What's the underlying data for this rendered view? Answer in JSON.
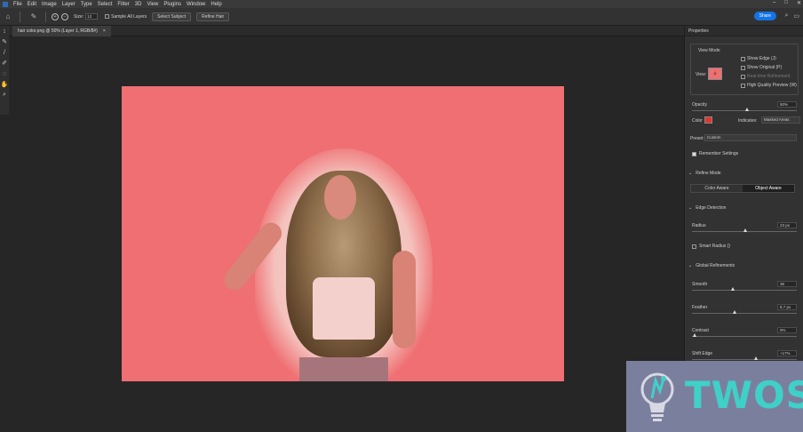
{
  "menubar": {
    "items": [
      "File",
      "Edit",
      "Image",
      "Layer",
      "Type",
      "Select",
      "Filter",
      "3D",
      "View",
      "Plugins",
      "Window",
      "Help"
    ],
    "win_controls": [
      "–",
      "□",
      "✕"
    ]
  },
  "options": {
    "size_label": "Size:",
    "size_value": "13",
    "sample_all_layers": "Sample All Layers",
    "select_subject": "Select Subject",
    "refine_hair": "Refine Hair",
    "share": "Share"
  },
  "document": {
    "tab_title": "hair color.png @ 50% (Layer 1, RGB/8#)",
    "close": "×"
  },
  "properties": {
    "title": "Properties",
    "view_mode_title": "View Mode",
    "view_label": "View:",
    "show_edge": "Show Edge (J)",
    "show_original": "Show Original (P)",
    "realtime_refinement": "Real-time Refinement",
    "high_quality_preview": "High Quality Preview (W)",
    "opacity_label": "Opacity",
    "opacity_value": "50%",
    "opacity_level": 0.5,
    "color_label": "Color",
    "color_hex": "#e8332b",
    "indicates_label": "Indicates:",
    "indicates_value": "Masked Areas",
    "preset_label": "Preset:",
    "preset_value": "Custom",
    "remember_settings": "Remember Settings",
    "refine_mode_title": "Refine Mode",
    "color_aware": "Color Aware",
    "object_aware": "Object Aware",
    "edge_detection_title": "Edge Detection",
    "radius_label": "Radius",
    "radius_value": "23 px",
    "smart_radius": "Smart Radius ()",
    "global_refinements_title": "Global Refinements",
    "smooth_label": "Smooth",
    "smooth_value": "36",
    "feather_label": "Feather",
    "feather_value": "8.7 px",
    "contrast_label": "Contrast",
    "contrast_value": "0%",
    "shift_edge_label": "Shift Edge",
    "shift_edge_value": "+17%"
  },
  "watermark": {
    "text": "TWOS"
  }
}
